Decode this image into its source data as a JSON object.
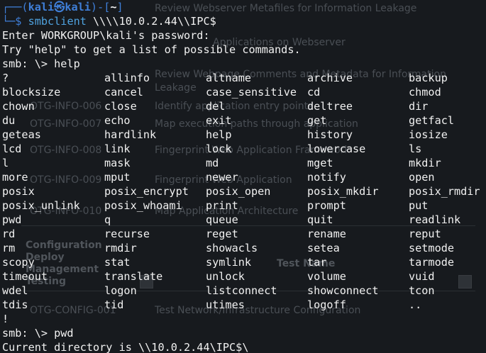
{
  "prompt": {
    "line1_prefix": "┌──(",
    "user_host": "kali㉿kali",
    "line1_mid": ")-[",
    "cwd": "~",
    "line1_suffix": "]",
    "line2_prefix": "└─$ ",
    "command": "smbclient",
    "command_args": " \\\\\\\\10.0.2.44\\\\IPC$"
  },
  "output_lines": [
    "Enter WORKGROUP\\kali's password:",
    "Try \"help\" to get a list of possible commands.",
    "smb: \\> help"
  ],
  "help_grid": [
    [
      "?",
      "allinfo",
      "altname",
      "archive",
      "backup"
    ],
    [
      "blocksize",
      "cancel",
      "case_sensitive",
      "cd",
      "chmod"
    ],
    [
      "chown",
      "close",
      "del",
      "deltree",
      "dir"
    ],
    [
      "du",
      "echo",
      "exit",
      "get",
      "getfacl"
    ],
    [
      "geteas",
      "hardlink",
      "help",
      "history",
      "iosize"
    ],
    [
      "lcd",
      "link",
      "lock",
      "lowercase",
      "ls"
    ],
    [
      "l",
      "mask",
      "md",
      "mget",
      "mkdir"
    ],
    [
      "more",
      "mput",
      "newer",
      "notify",
      "open"
    ],
    [
      "posix",
      "posix_encrypt",
      "posix_open",
      "posix_mkdir",
      "posix_rmdir"
    ],
    [
      "posix_unlink",
      "posix_whoami",
      "print",
      "prompt",
      "put"
    ],
    [
      "pwd",
      "q",
      "queue",
      "quit",
      "readlink"
    ],
    [
      "rd",
      "recurse",
      "reget",
      "rename",
      "reput"
    ],
    [
      "rm",
      "rmdir",
      "showacls",
      "setea",
      "setmode"
    ],
    [
      "scopy",
      "stat",
      "symlink",
      "tar",
      "tarmode"
    ],
    [
      "timeout",
      "translate",
      "unlock",
      "volume",
      "vuid"
    ],
    [
      "wdel",
      "logon",
      "listconnect",
      "showconnect",
      "tcon"
    ],
    [
      "tdis",
      "tid",
      "utimes",
      "logoff",
      ".."
    ]
  ],
  "trailing_lines": [
    "!",
    "smb: \\> pwd",
    "Current directory is \\\\10.0.2.44\\IPC$\\"
  ],
  "background": {
    "row1": "Review Webserver Metafiles for Information Leakage",
    "row2": "Applications on Webserver",
    "row3": "Review Webpage Comments and Metadata for Information",
    "row3b": "Leakage",
    "row4_id": "OTG-INFO-006",
    "row4": "Identify application entry points",
    "row5_id": "OTG-INFO-007",
    "row5": "Map execution paths through application",
    "row6_id": "OTG-INFO-008",
    "row6": "Fingerprint Web Application Framework",
    "row7_id": "OTG-INFO-009",
    "row7": "Fingerprint Web Application",
    "row8_id": "OTG-INFO-010",
    "row8": "Map Application Architecture",
    "section_1": "Configuration",
    "section_2": "Deploy",
    "section_3": "Management",
    "section_4": "Testing",
    "col_header": "Test Name",
    "row9_id": "OTG-CONFIG-001",
    "row9": "Test Network/Infrastructure Configuration"
  }
}
